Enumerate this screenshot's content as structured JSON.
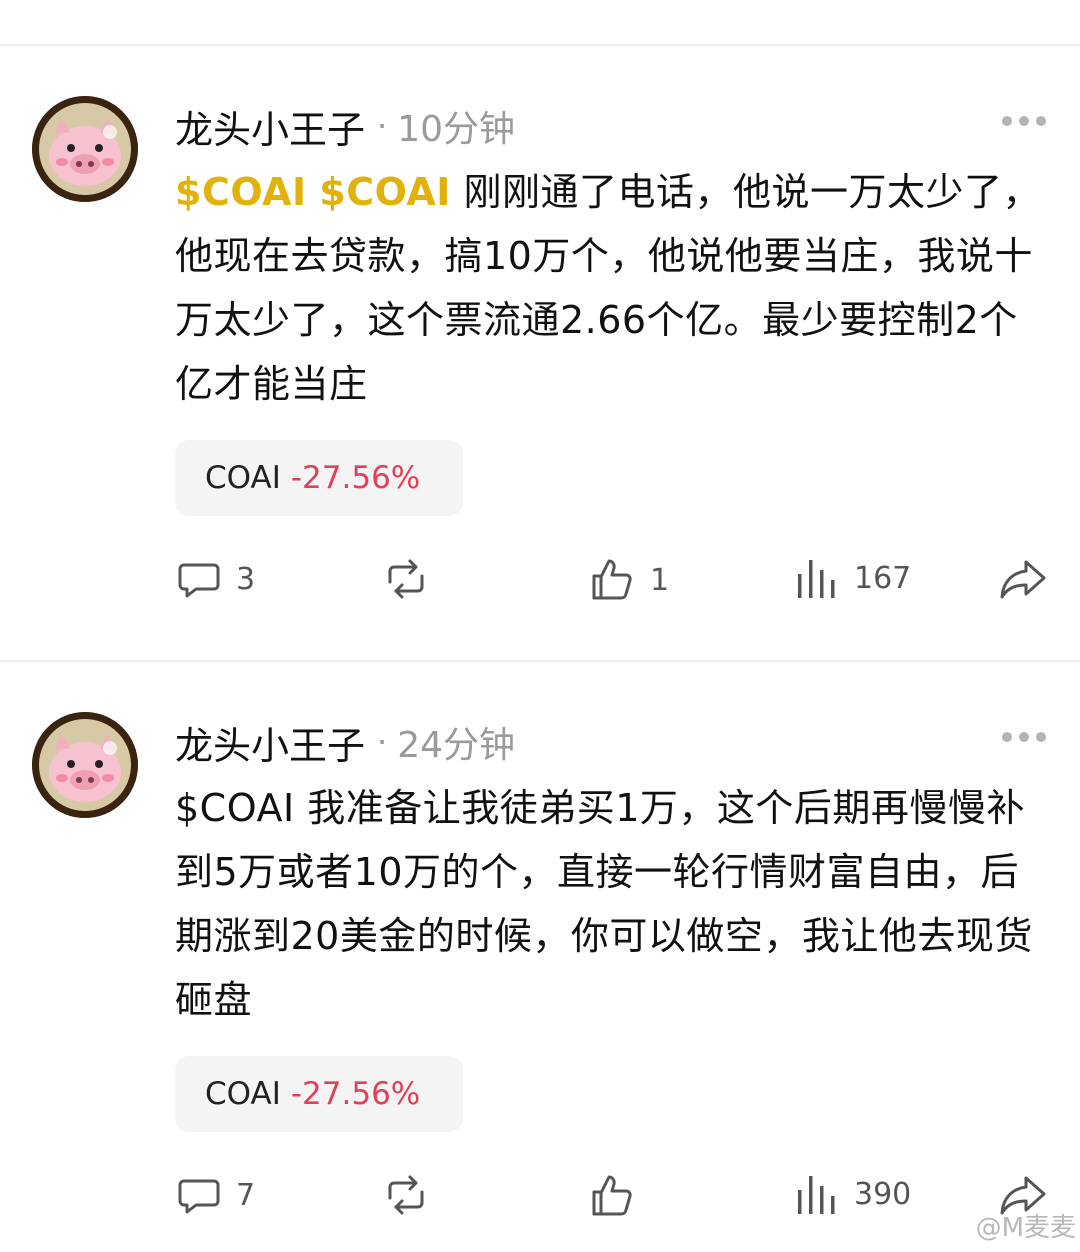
{
  "posts": [
    {
      "username": "龙头小王子",
      "separator": "·",
      "time": "10分钟",
      "cashtags": [
        "$COAI",
        "$COAI"
      ],
      "text": "刚刚通了电话，他说一万太少了，他现在去贷款，搞10万个，他说他要当庄，我说十万太少了，这个票流通2.66个亿。最少要控制2个亿才能当庄",
      "ticker": {
        "name": "COAI",
        "change": "-27.56%"
      },
      "stats": {
        "replies": "3",
        "reposts": "",
        "likes": "1",
        "views": "167"
      }
    },
    {
      "username": "龙头小王子",
      "separator": "·",
      "time": "24分钟",
      "cashtags": [
        "$COAI"
      ],
      "text": "我准备让我徒弟买1万，这个后期再慢慢补到5万或者10万的个，直接一轮行情财富自由，后期涨到20美金的时候，你可以做空，我让他去现货砸盘",
      "ticker": {
        "name": "COAI",
        "change": "-27.56%"
      },
      "stats": {
        "replies": "7",
        "reposts": "",
        "likes": "",
        "views": "390"
      }
    }
  ],
  "watermark": "@M麦麦",
  "colors": {
    "cashtag_highlight": "#e2b20c",
    "negative_change": "#e0405a",
    "muted": "#9a9a9a"
  }
}
